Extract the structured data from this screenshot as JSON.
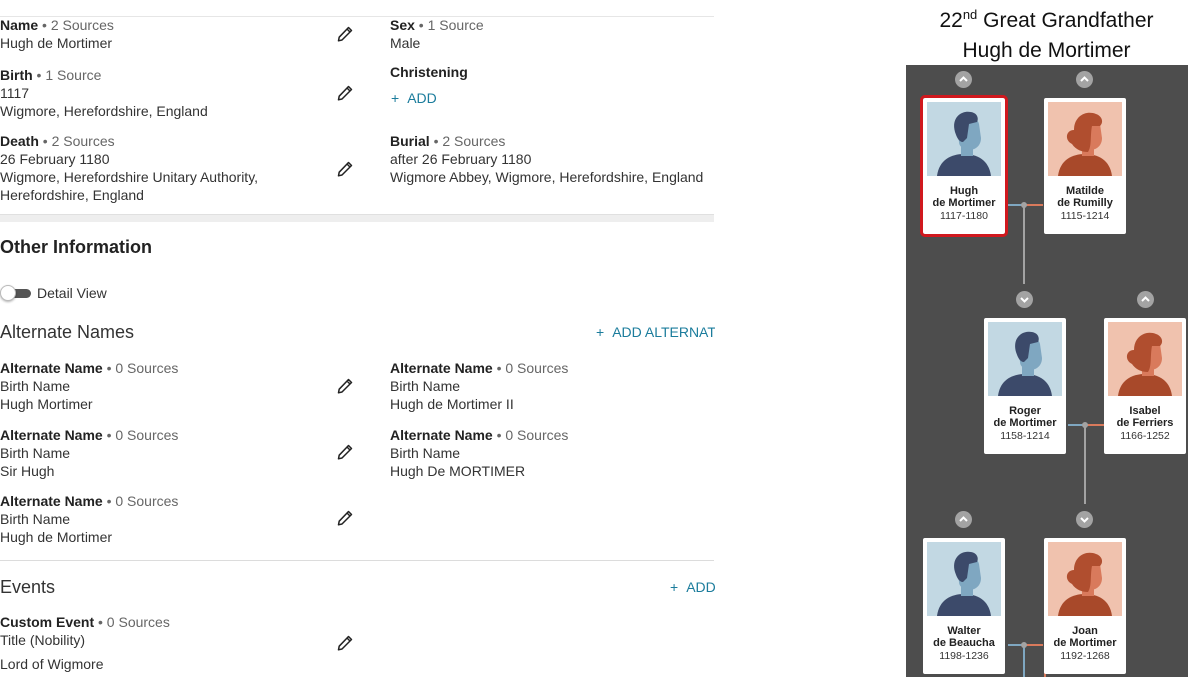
{
  "facts": {
    "name": {
      "label": "Name",
      "sources": " • 2 Sources",
      "lines": [
        "Hugh de Mortimer"
      ]
    },
    "sex": {
      "label": "Sex",
      "sources": " • 1 Source",
      "lines": [
        "Male"
      ]
    },
    "birth": {
      "label": "Birth",
      "sources": " • 1 Source",
      "lines": [
        "1117",
        "Wigmore, Herefordshire, England"
      ]
    },
    "christening": {
      "label": "Christening",
      "add_label": "ADD"
    },
    "death": {
      "label": "Death",
      "sources": " • 2 Sources",
      "lines": [
        "26 February 1180",
        "Wigmore, Herefordshire Unitary Authority,",
        "Herefordshire, England"
      ]
    },
    "burial": {
      "label": "Burial",
      "sources": " • 2 Sources",
      "lines": [
        "after 26 February 1180",
        "Wigmore Abbey, Wigmore, Herefordshire, England"
      ]
    }
  },
  "other": {
    "heading": "Other Information",
    "toggle_label": "Detail View",
    "alternate_names_heading": "Alternate Names",
    "add_alternate_label": "ADD ALTERNATE",
    "alternates": [
      {
        "label": "Alternate Name",
        "sources": " • 0 Sources",
        "lines": [
          "Birth Name",
          "Hugh Mortimer"
        ]
      },
      {
        "label": "Alternate Name",
        "sources": " • 0 Sources",
        "lines": [
          "Birth Name",
          "Hugh de Mortimer II"
        ]
      },
      {
        "label": "Alternate Name",
        "sources": " • 0 Sources",
        "lines": [
          "Birth Name",
          "Sir Hugh"
        ]
      },
      {
        "label": "Alternate Name",
        "sources": " • 0 Sources",
        "lines": [
          "Birth Name",
          "Hugh De MORTIMER"
        ]
      },
      {
        "label": "Alternate Name",
        "sources": " • 0 Sources",
        "lines": [
          "Birth Name",
          "Hugh de Mortimer"
        ]
      }
    ],
    "events_heading": "Events",
    "add_event_label": "ADD",
    "events": [
      {
        "label": "Custom Event",
        "sources": " • 0 Sources",
        "lines": [
          "Title (Nobility)",
          "Lord of Wigmore"
        ]
      }
    ]
  },
  "chart": {
    "title_ordinal": "22",
    "title_suffix": "nd",
    "title_rest": " Great Grandfather",
    "title_name": "Hugh de Mortimer",
    "people": [
      {
        "first": "Hugh",
        "last": "de Mortimer",
        "dates": "1117-1180",
        "gender": "male",
        "selected": true
      },
      {
        "first": "Matilde",
        "last": "de Rumilly",
        "dates": "1115-1214",
        "gender": "female",
        "selected": false
      },
      {
        "first": "Roger",
        "last": "de Mortimer",
        "dates": "1158-1214",
        "gender": "male",
        "selected": false
      },
      {
        "first": "Isabel",
        "last": "de Ferriers",
        "dates": "1166-1252",
        "gender": "female",
        "selected": false
      },
      {
        "first": "Walter",
        "last": "de Beaucha",
        "dates": "1198-1236",
        "gender": "male",
        "selected": false
      },
      {
        "first": "Joan",
        "last": "de Mortimer",
        "dates": "1192-1268",
        "gender": "female",
        "selected": false
      }
    ],
    "colors": {
      "background": "#4d4d4d",
      "male_bg": "#c2d8e3",
      "male_face": "#7fa7c1",
      "male_hair": "#3c4a6a",
      "male_body": "#3c4a6a",
      "female_bg": "#f0c2ae",
      "female_face": "#d97a5c",
      "female_hair": "#b04e2f",
      "female_body": "#a8492a",
      "selected_border": "#d0181e",
      "male_line": "#7fa7c1",
      "female_line": "#d97a5c"
    }
  },
  "icons": {
    "edit": "pencil-icon",
    "expand_up": "chevron-up-icon",
    "expand_down": "chevron-down-icon",
    "add": "plus-icon"
  }
}
